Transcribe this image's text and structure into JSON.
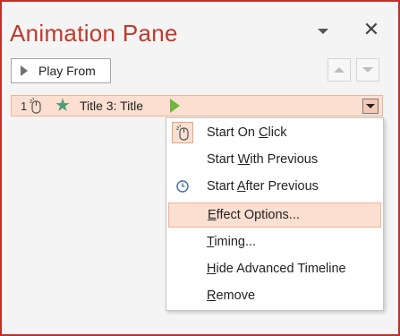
{
  "pane": {
    "title": "Animation Pane",
    "play_from_label": "Play From"
  },
  "row": {
    "number": "1",
    "label": "Title 3: Title"
  },
  "menu": {
    "items": [
      {
        "id": "start-on-click",
        "pre": "Start On ",
        "key": "C",
        "post": "lick",
        "icon": "mouse-icon",
        "checked": true
      },
      {
        "id": "start-with-previous",
        "pre": "Start ",
        "key": "W",
        "post": "ith Previous",
        "icon": "",
        "checked": false
      },
      {
        "id": "start-after-previous",
        "pre": "Start ",
        "key": "A",
        "post": "fter Previous",
        "icon": "clock-icon",
        "checked": false
      },
      {
        "id": "effect-options",
        "pre": "",
        "key": "E",
        "post": "ffect Options...",
        "icon": "",
        "hover": true
      },
      {
        "id": "timing",
        "pre": "",
        "key": "T",
        "post": "iming...",
        "icon": ""
      },
      {
        "id": "hide-advanced-timeline",
        "pre": "",
        "key": "H",
        "post": "ide Advanced Timeline",
        "icon": ""
      },
      {
        "id": "remove",
        "pre": "",
        "key": "R",
        "post": "emove",
        "icon": ""
      }
    ]
  },
  "colors": {
    "accent": "#c0392b",
    "highlight": "#fbdfd1",
    "star": "#4d9d76",
    "play": "#6fb63d"
  }
}
